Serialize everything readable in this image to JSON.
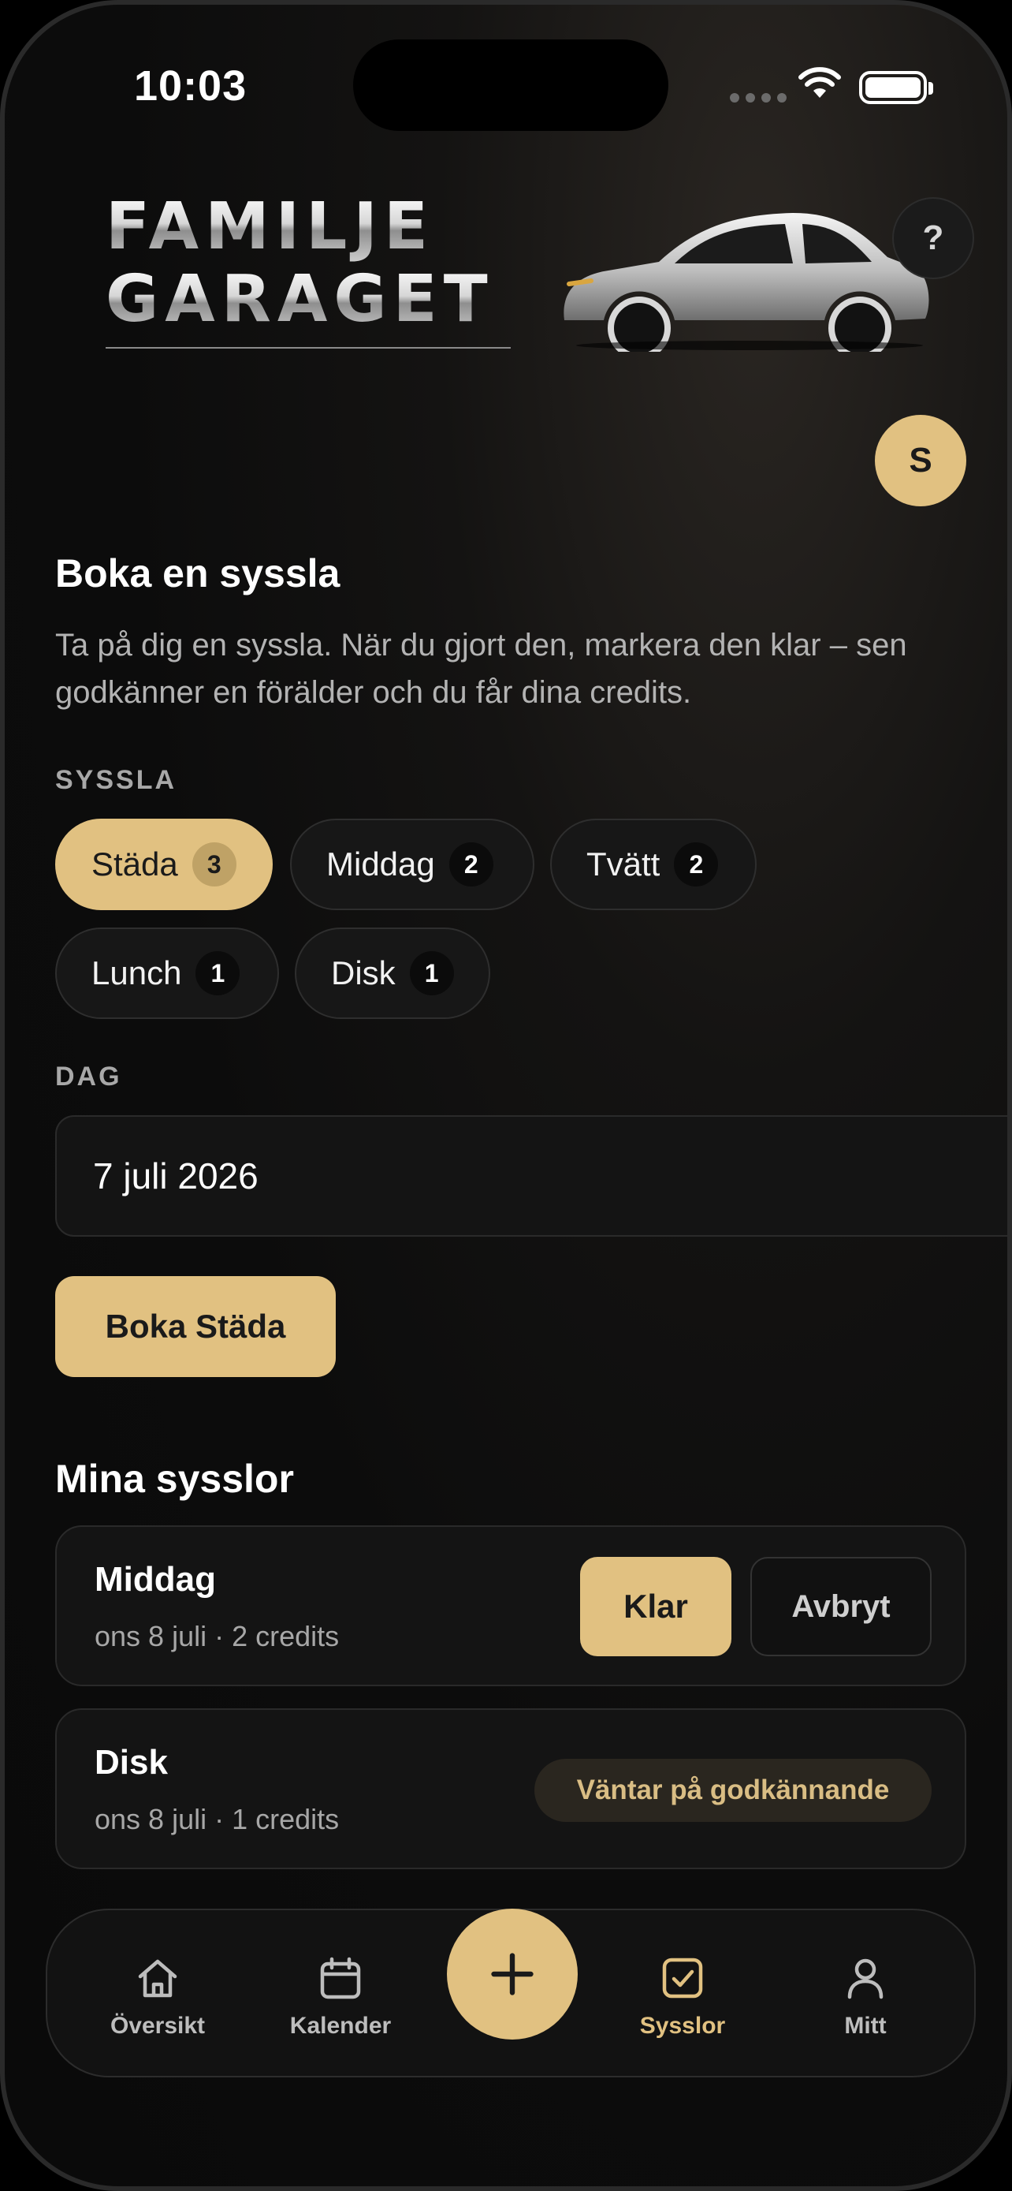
{
  "status_bar": {
    "time": "10:03"
  },
  "header": {
    "logo_line1": "FAMILJE",
    "logo_line2": "GARAGET",
    "help_label": "?",
    "avatar_initial": "S"
  },
  "booking": {
    "title": "Boka en syssla",
    "description": "Ta på dig en syssla. När du gjort den, markera den klar – sen godkänner en förälder och du får dina credits.",
    "chore_label": "SYSSLA",
    "chores": [
      {
        "label": "Städa",
        "count": "3",
        "selected": true
      },
      {
        "label": "Middag",
        "count": "2",
        "selected": false
      },
      {
        "label": "Tvätt",
        "count": "2",
        "selected": false
      },
      {
        "label": "Lunch",
        "count": "1",
        "selected": false
      },
      {
        "label": "Disk",
        "count": "1",
        "selected": false
      }
    ],
    "day_label": "DAG",
    "day_value": "7 juli 2026",
    "book_button": "Boka Städa"
  },
  "my_chores": {
    "title": "Mina sysslor",
    "items": [
      {
        "name": "Middag",
        "meta": "ons 8 juli · 2 credits",
        "done_button": "Klar",
        "cancel_button": "Avbryt"
      },
      {
        "name": "Disk",
        "meta": "ons 8 juli · 1 credits",
        "status": "Väntar på godkännande"
      }
    ]
  },
  "tabbar": {
    "tabs": [
      {
        "label": "Översikt",
        "icon": "home-icon",
        "active": false
      },
      {
        "label": "Kalender",
        "icon": "calendar-icon",
        "active": false
      },
      {
        "label": "Sysslor",
        "icon": "checkbox-icon",
        "active": true
      },
      {
        "label": "Mitt",
        "icon": "person-icon",
        "active": false
      }
    ],
    "fab_icon": "plus-icon"
  },
  "colors": {
    "accent": "#e1c181",
    "background": "#0c0c0c",
    "card": "#141414"
  }
}
